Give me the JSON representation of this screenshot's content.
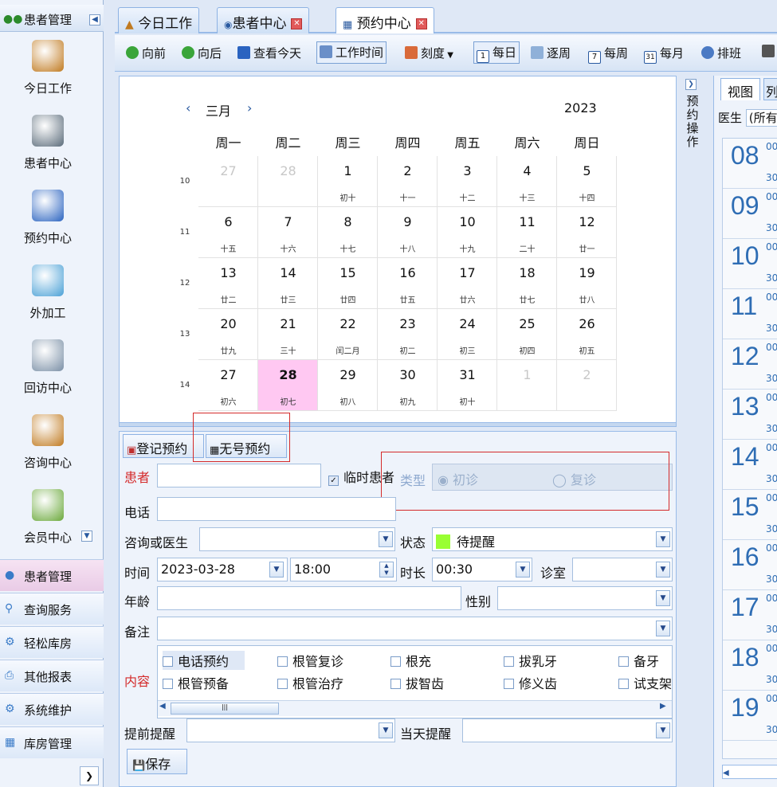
{
  "sidebar": {
    "header_title": "患者管理",
    "nav": [
      {
        "label": "今日工作",
        "icon": "doctor-desk-icon"
      },
      {
        "label": "患者中心",
        "icon": "binoculars-icon"
      },
      {
        "label": "预约中心",
        "icon": "calendar-icon"
      },
      {
        "label": "外加工",
        "icon": "cubes-icon"
      },
      {
        "label": "回访中心",
        "icon": "refresh-icon"
      },
      {
        "label": "咨询中心",
        "icon": "consultant-icon"
      },
      {
        "label": "会员中心",
        "icon": "members-icon"
      }
    ],
    "bottom": [
      {
        "label": "患者管理",
        "icon": "people-icon"
      },
      {
        "label": "查询服务",
        "icon": "search-icon"
      },
      {
        "label": "轻松库房",
        "icon": "warehouse-icon"
      },
      {
        "label": "其他报表",
        "icon": "printer-icon"
      },
      {
        "label": "系统维护",
        "icon": "gears-icon"
      },
      {
        "label": "库房管理",
        "icon": "inventory-icon"
      }
    ]
  },
  "tabs": [
    {
      "label": "今日工作",
      "closable": false
    },
    {
      "label": "患者中心",
      "closable": true
    },
    {
      "label": "预约中心",
      "closable": true,
      "active": true
    }
  ],
  "toolbar": {
    "prev": "向前",
    "next": "向后",
    "today": "查看今天",
    "worktime": "工作时间",
    "scale": "刻度",
    "daily": "每日",
    "byweek": "逐周",
    "weekly": "每周",
    "monthly": "每月",
    "schedule": "排班"
  },
  "calendar": {
    "month": "三月",
    "year": "2023",
    "dow": [
      "周一",
      "周二",
      "周三",
      "周四",
      "周五",
      "周六",
      "周日"
    ],
    "weeks": [
      {
        "no": "10",
        "days": [
          [
            "27",
            "",
            true
          ],
          [
            "28",
            "",
            true
          ],
          [
            "1",
            "初十",
            false
          ],
          [
            "2",
            "十一",
            false
          ],
          [
            "3",
            "十二",
            false
          ],
          [
            "4",
            "十三",
            false
          ],
          [
            "5",
            "十四",
            false
          ]
        ]
      },
      {
        "no": "11",
        "days": [
          [
            "6",
            "十五",
            false
          ],
          [
            "7",
            "十六",
            false
          ],
          [
            "8",
            "十七",
            false
          ],
          [
            "9",
            "十八",
            false
          ],
          [
            "10",
            "十九",
            false
          ],
          [
            "11",
            "二十",
            false
          ],
          [
            "12",
            "廿一",
            false
          ]
        ]
      },
      {
        "no": "12",
        "days": [
          [
            "13",
            "廿二",
            false
          ],
          [
            "14",
            "廿三",
            false
          ],
          [
            "15",
            "廿四",
            false
          ],
          [
            "16",
            "廿五",
            false
          ],
          [
            "17",
            "廿六",
            false
          ],
          [
            "18",
            "廿七",
            false
          ],
          [
            "19",
            "廿八",
            false
          ]
        ]
      },
      {
        "no": "13",
        "days": [
          [
            "20",
            "廿九",
            false
          ],
          [
            "21",
            "三十",
            false
          ],
          [
            "22",
            "闰二月",
            false
          ],
          [
            "23",
            "初二",
            false
          ],
          [
            "24",
            "初三",
            false
          ],
          [
            "25",
            "初四",
            false
          ],
          [
            "26",
            "初五",
            false
          ]
        ]
      },
      {
        "no": "14",
        "days": [
          [
            "27",
            "初六",
            false
          ],
          [
            "28",
            "初七",
            false
          ],
          [
            "29",
            "初八",
            false
          ],
          [
            "30",
            "初九",
            false
          ],
          [
            "31",
            "初十",
            false
          ],
          [
            "1",
            "",
            true
          ],
          [
            "2",
            "",
            true
          ]
        ]
      }
    ],
    "today_index": [
      4,
      1
    ]
  },
  "side_panel": {
    "title": "预约操作"
  },
  "right": {
    "tab": "视图",
    "tab2": "列",
    "doctor_label": "医生",
    "doctor_value": "(所有",
    "hours": [
      "08",
      "09",
      "10",
      "11",
      "12",
      "13",
      "14",
      "15",
      "16",
      "17",
      "18",
      "19"
    ],
    "min_top": "00",
    "min_half": "30"
  },
  "form": {
    "register_btn": "登记预约",
    "nonumber_btn": "无号预约",
    "patient_label": "患者",
    "temp_patient_label": "临时患者",
    "type_label": "类型",
    "type_first": "初诊",
    "type_return": "复诊",
    "phone_label": "电话",
    "consult_label": "咨询或医生",
    "status_label": "状态",
    "status_value": "待提醒",
    "status_color": "#99ff33",
    "time_label": "时间",
    "date_value": "2023-03-28",
    "time_value": "18:00",
    "duration_label": "时长",
    "duration_value": "00:30",
    "room_label": "诊室",
    "age_label": "年龄",
    "gender_label": "性别",
    "note_label": "备注",
    "content_label": "内容",
    "content_items": [
      "电话预约",
      "根管复诊",
      "根充",
      "拔乳牙",
      "备牙",
      "根管预备",
      "根管治疗",
      "拔智齿",
      "修义齿",
      "试支架"
    ],
    "remind_before_label": "提前提醒",
    "remind_day_label": "当天提醒",
    "save_btn": "保存"
  }
}
